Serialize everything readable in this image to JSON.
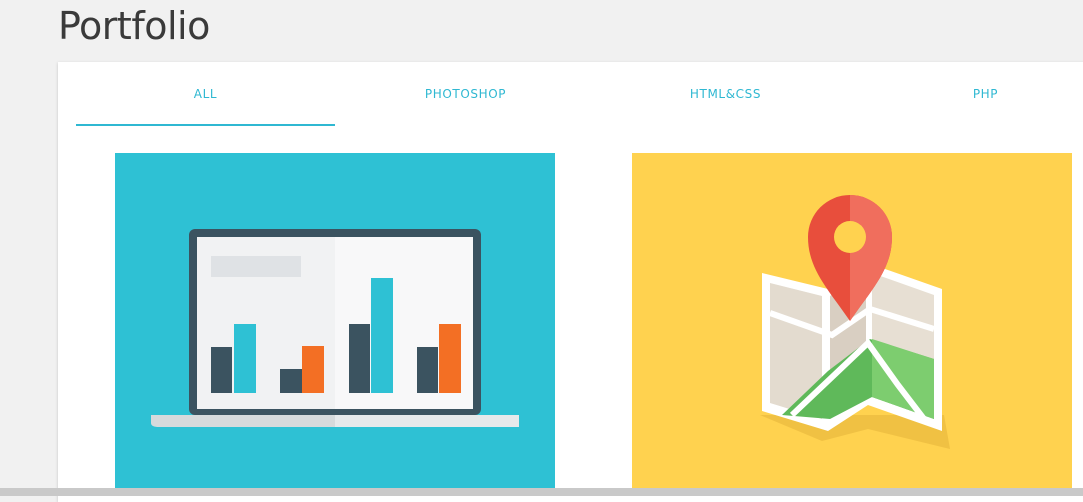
{
  "page": {
    "title": "Portfolio"
  },
  "colors": {
    "accent": "#2fb8d2",
    "card_laptop_bg": "#2ec1d4",
    "card_map_bg": "#ffd24f",
    "bar_dark": "#3b5360",
    "bar_blue": "#2ec1d4",
    "bar_orange": "#f36f24",
    "pin_red": "#e84e3c",
    "map_green": "#5fb95a"
  },
  "tabs": [
    {
      "label": "ALL",
      "active": true
    },
    {
      "label": "PHOTOSHOP",
      "active": false
    },
    {
      "label": "HTML&CSS",
      "active": false
    },
    {
      "label": "PHP",
      "active": false
    }
  ],
  "cards": [
    {
      "icon": "laptop-chart-icon"
    },
    {
      "icon": "map-pin-icon"
    }
  ]
}
